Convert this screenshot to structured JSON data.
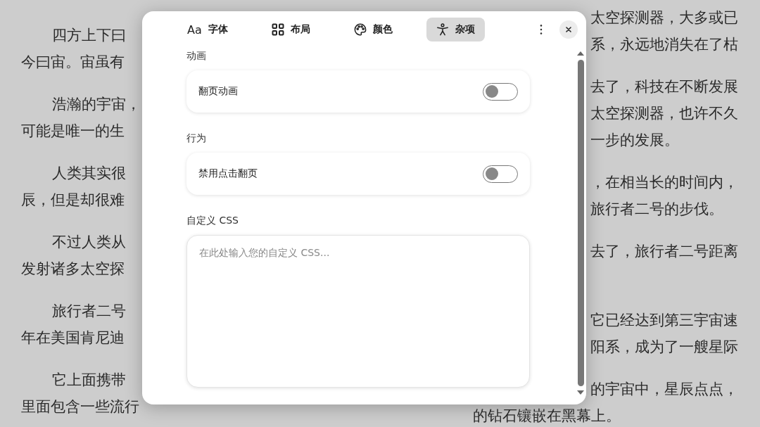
{
  "book": {
    "left_paragraphs": [
      {
        "lines": [
          "四方上下曰",
          "今曰宙。宙虽有"
        ]
      },
      {
        "lines": [
          "浩瀚的宇宙，",
          "可能是唯一的生"
        ]
      },
      {
        "lines": [
          "人类其实很",
          "辰，但是却很难"
        ]
      },
      {
        "lines": [
          "不过人类从",
          "发射诸多太空探"
        ]
      },
      {
        "lines": [
          "旅行者二号",
          "年在美国肯尼迪"
        ]
      },
      {
        "lines": [
          "它上面携带",
          "里面包含一些流行"
        ]
      }
    ],
    "right_paragraphs": [
      {
        "lines": [
          "太空探测器，大多或已",
          "系，永远地消失在了枯"
        ]
      },
      {
        "lines": [
          "去了，科技在不断发展",
          "太空探测器，也许不久",
          "一步的发展。"
        ]
      },
      {
        "lines": [
          "，在相当长的时间内，",
          "旅行者二号的步伐。"
        ]
      },
      {
        "lines": [
          "去了，旅行者二号距离"
        ]
      },
      {
        "lines": [
          "它已经达到第三宇宙速",
          "阳系，成为了一艘星际"
        ]
      },
      {
        "lines": [
          "的宇宙中，星辰点点，"
        ]
      }
    ],
    "bottom_line": "的钻石镶嵌在黑幕上。"
  },
  "dialog": {
    "tabs": [
      {
        "label": "字体",
        "icon_text": "Aa",
        "selected": false
      },
      {
        "label": "布局",
        "selected": false
      },
      {
        "label": "颜色",
        "selected": false
      },
      {
        "label": "杂项",
        "selected": true
      }
    ],
    "sections": [
      {
        "heading": "动画",
        "kind": "toggle",
        "label": "翻页动画",
        "on": false
      },
      {
        "heading": "行为",
        "kind": "toggle",
        "label": "禁用点击翻页",
        "on": false
      },
      {
        "heading": "自定义 CSS",
        "kind": "textarea",
        "placeholder": "在此处输入您的自定义 CSS..."
      }
    ]
  }
}
